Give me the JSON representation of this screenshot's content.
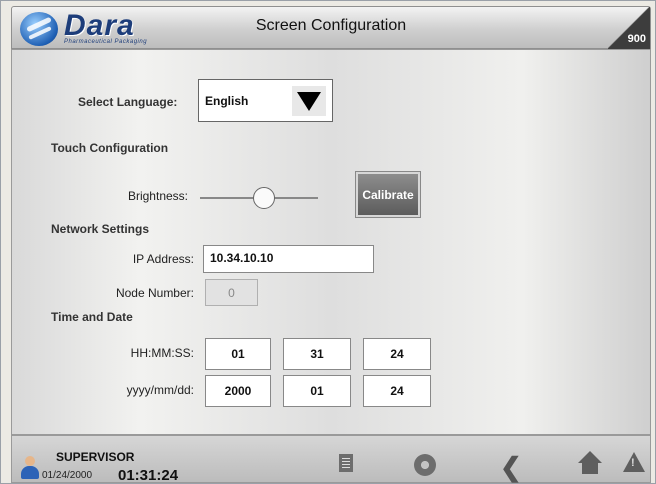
{
  "header": {
    "logo_text": "Dara",
    "logo_subtext": "Pharmaceutical Packaging",
    "title": "Screen Configuration",
    "badge": "900"
  },
  "language": {
    "label": "Select Language:",
    "value": "English"
  },
  "touch": {
    "heading": "Touch Configuration",
    "brightness_label": "Brightness:",
    "brightness_level": 0.55,
    "calibrate_label": "Calibrate"
  },
  "network": {
    "heading": "Network Settings",
    "ip_label": "IP Address:",
    "ip_value": "10.34.10.10",
    "node_label": "Node Number:",
    "node_value": "0"
  },
  "datetime": {
    "heading": "Time and Date",
    "time_label": "HH:MM:SS:",
    "hh": "01",
    "mm": "31",
    "ss": "24",
    "date_label": "yyyy/mm/dd:",
    "yyyy": "2000",
    "month": "01",
    "day": "24"
  },
  "footer": {
    "role": "SUPERVISOR",
    "date": "01/24/2000",
    "time": "01:31:24",
    "icons": [
      "document-icon",
      "gear-icon",
      "back-icon",
      "home-icon",
      "warning-icon"
    ]
  }
}
